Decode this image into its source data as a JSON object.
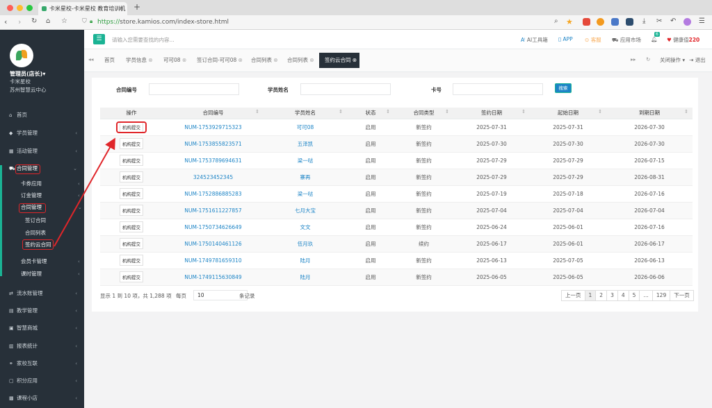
{
  "browser": {
    "tab_title": "卡米星校-卡米星校 教育培训机",
    "new_tab": "+",
    "url_scheme": "https://",
    "url_rest": "store.kamios.com/index-store.html"
  },
  "sidebar": {
    "user_name": "管理员(店长)",
    "user_name_caret": "▾",
    "brand": "卡米星校",
    "center": "苏州智慧云中心",
    "menu": [
      {
        "label": "首页",
        "icon": "home-icon"
      },
      {
        "label": "学员管理",
        "icon": "users-icon"
      },
      {
        "label": "活动管理",
        "icon": "calendar-icon"
      },
      {
        "label": "合同管理",
        "icon": "cart-icon"
      },
      {
        "label": "流水账管理",
        "icon": "exchange-icon"
      },
      {
        "label": "教学管理",
        "icon": "book-icon"
      },
      {
        "label": "智慧商城",
        "icon": "shop-icon"
      },
      {
        "label": "报表统计",
        "icon": "chart-icon"
      },
      {
        "label": "家校互联",
        "icon": "link-icon"
      },
      {
        "label": "积分应用",
        "icon": "gift-icon"
      },
      {
        "label": "课程小店",
        "icon": "store-icon"
      }
    ],
    "contract_sub": [
      {
        "label": "卡券应用"
      },
      {
        "label": "订金管理"
      },
      {
        "label": "合同管理"
      }
    ],
    "contract_leaf": [
      {
        "label": "签订合同"
      },
      {
        "label": "合同列表"
      },
      {
        "label": "签约云合同"
      }
    ],
    "contract_sub2": [
      {
        "label": "会员卡管理"
      },
      {
        "label": "课时管理"
      }
    ]
  },
  "header": {
    "menu_glyph": "☰",
    "search_placeholder": "请输入您需要查找的内容...",
    "ai_tool": "AI工具箱",
    "app": "APP",
    "service": "客服",
    "app_market": "应用市场",
    "notif_count": "6",
    "health_label": "健康值",
    "health_value": "220"
  },
  "tabs": {
    "items": [
      "首页",
      "学员信息",
      "可可08",
      "签订合同-可可08",
      "合同列表",
      "合同列表"
    ],
    "active": "签约云合同",
    "close_ops": "关闭操作",
    "logout": "退出"
  },
  "filters": {
    "contract_no_label": "合同编号",
    "student_name_label": "学员姓名",
    "card_no_label": "卡号",
    "search_button": "搜索"
  },
  "table": {
    "headers": [
      "操作",
      "合同编号",
      "学员姓名",
      "状态",
      "合同类型",
      "签约日期",
      "起始日期",
      "到期日期"
    ],
    "op_label": "机构提交",
    "rows": [
      {
        "no": "NUM-1753929715323",
        "name": "可可08",
        "status": "启用",
        "type": "新签约",
        "sign": "2025-07-31",
        "start": "2025-07-31",
        "end": "2026-07-30"
      },
      {
        "no": "NUM-1753855823571",
        "name": "五泽凯",
        "status": "启用",
        "type": "新签约",
        "sign": "2025-07-30",
        "start": "2025-07-30",
        "end": "2026-07-30"
      },
      {
        "no": "NUM-1753789694631",
        "name": "梁一哒",
        "status": "启用",
        "type": "新签约",
        "sign": "2025-07-29",
        "start": "2025-07-29",
        "end": "2026-07-15"
      },
      {
        "no": "324523452345",
        "name": "寨再",
        "status": "启用",
        "type": "新签约",
        "sign": "2025-07-29",
        "start": "2025-07-29",
        "end": "2026-08-31"
      },
      {
        "no": "NUM-1752886885283",
        "name": "梁一哒",
        "status": "启用",
        "type": "新签约",
        "sign": "2025-07-19",
        "start": "2025-07-18",
        "end": "2026-07-16"
      },
      {
        "no": "NUM-1751611227857",
        "name": "七月大宝",
        "status": "启用",
        "type": "新签约",
        "sign": "2025-07-04",
        "start": "2025-07-04",
        "end": "2026-07-04"
      },
      {
        "no": "NUM-1750734626649",
        "name": "文文",
        "status": "启用",
        "type": "新签约",
        "sign": "2025-06-24",
        "start": "2025-06-01",
        "end": "2026-07-16"
      },
      {
        "no": "NUM-1750140461126",
        "name": "伍月玖",
        "status": "启用",
        "type": "续约",
        "sign": "2025-06-17",
        "start": "2025-06-01",
        "end": "2026-06-17"
      },
      {
        "no": "NUM-1749781659310",
        "name": "陆月",
        "status": "启用",
        "type": "新签约",
        "sign": "2025-06-13",
        "start": "2025-07-05",
        "end": "2026-06-13"
      },
      {
        "no": "NUM-1749115630849",
        "name": "陆月",
        "status": "启用",
        "type": "新签约",
        "sign": "2025-06-05",
        "start": "2025-06-05",
        "end": "2026-06-06"
      }
    ]
  },
  "pagination": {
    "summary": "显示 1 到 10 项，共 1,288 项",
    "per_page_label": "每页",
    "per_page_value": "10",
    "records_label": "条记录",
    "pages": [
      "上一页",
      "1",
      "2",
      "3",
      "4",
      "5",
      "…",
      "129",
      "下一页"
    ]
  },
  "colors": {
    "sidebar_bg": "#273039",
    "accent_green": "#1ab394",
    "link_blue": "#1c84c6",
    "annotation_red": "#e0262a"
  }
}
